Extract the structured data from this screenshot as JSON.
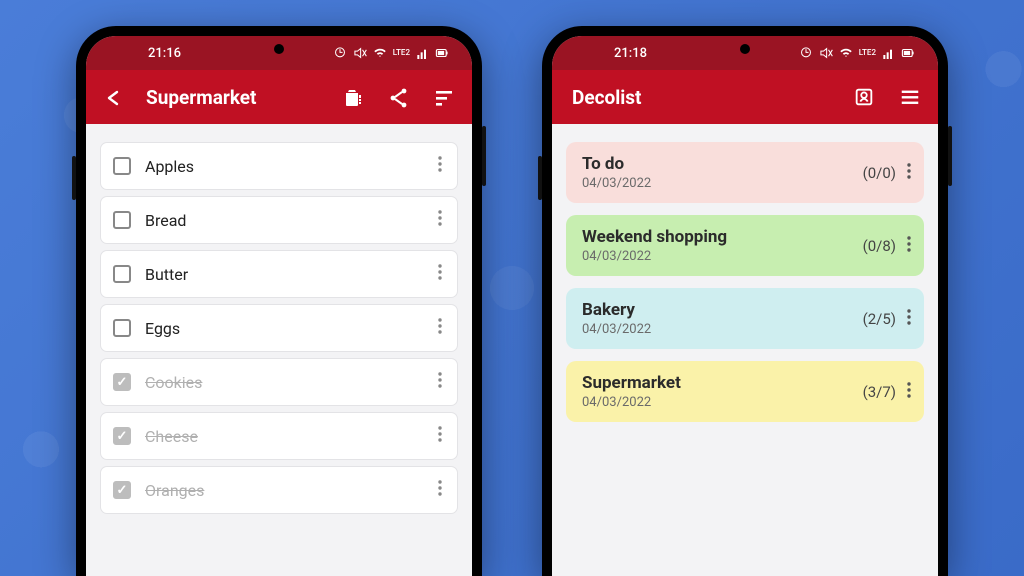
{
  "colors": {
    "brand_red": "#c01023",
    "brand_red_dark": "#9a1423"
  },
  "left": {
    "status_time": "21:16",
    "status_net": "LTE2",
    "title": "Supermarket",
    "items": [
      {
        "label": "Apples",
        "done": false
      },
      {
        "label": "Bread",
        "done": false
      },
      {
        "label": "Butter",
        "done": false
      },
      {
        "label": "Eggs",
        "done": false
      },
      {
        "label": "Cookies",
        "done": true
      },
      {
        "label": "Cheese",
        "done": true
      },
      {
        "label": "Oranges",
        "done": true
      }
    ]
  },
  "right": {
    "status_time": "21:18",
    "status_net": "LTE2",
    "title": "Decolist",
    "lists": [
      {
        "title": "To do",
        "date": "04/03/2022",
        "count": "(0/0)",
        "color": "pink"
      },
      {
        "title": "Weekend shopping",
        "date": "04/03/2022",
        "count": "(0/8)",
        "color": "green"
      },
      {
        "title": "Bakery",
        "date": "04/03/2022",
        "count": "(2/5)",
        "color": "blue"
      },
      {
        "title": "Supermarket",
        "date": "04/03/2022",
        "count": "(3/7)",
        "color": "yellow"
      }
    ]
  }
}
